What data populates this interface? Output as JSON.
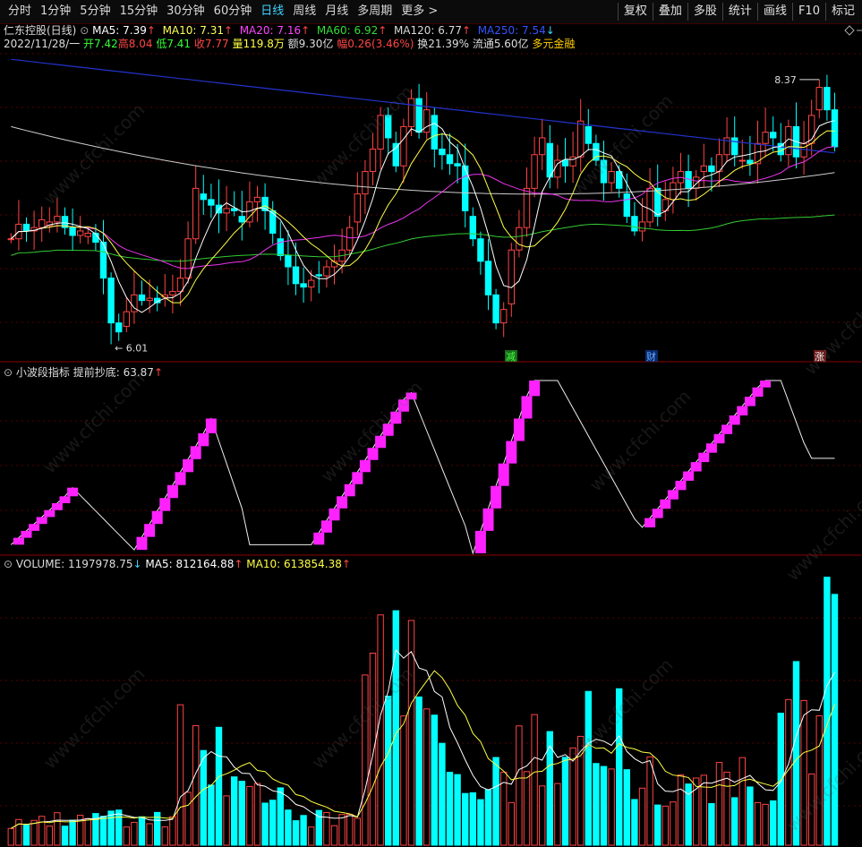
{
  "toolbar": {
    "periods": [
      "分时",
      "1分钟",
      "5分钟",
      "15分钟",
      "30分钟",
      "60分钟",
      "日线",
      "周线",
      "月线",
      "多周期",
      "更多"
    ],
    "active_period": "日线",
    "right_buttons": [
      "复权",
      "叠加",
      "多股",
      "统计",
      "画线",
      "F10",
      "标记"
    ]
  },
  "stock": {
    "name": "仁东控股(日线)",
    "ma": [
      {
        "label": "MA5: 7.39",
        "arrow": "↑",
        "color": "#ffffff"
      },
      {
        "label": "MA10: 7.31",
        "arrow": "↑",
        "color": "#ffff55"
      },
      {
        "label": "MA20: 7.16",
        "arrow": "↑",
        "color": "#ff44ff"
      },
      {
        "label": "MA60: 6.92",
        "arrow": "↑",
        "color": "#33dd33"
      },
      {
        "label": "MA120: 6.77",
        "arrow": "↑",
        "color": "#d8d8d8"
      },
      {
        "label": "MA250: 7.54",
        "arrow": "↓",
        "color": "#3355ff"
      }
    ],
    "quote": {
      "date": "2022/11/28/一",
      "open": "开7.42",
      "high": "高8.04",
      "low": "低7.41",
      "close": "收7.77",
      "vol": "量119.8万",
      "amount": "额9.30亿",
      "change": "幅0.26(3.46%)",
      "turnover": "换21.39%",
      "float": "流通5.60亿",
      "tag": "多元金融"
    },
    "high_mark": "8.37",
    "low_mark": "6.01",
    "events": [
      "减",
      "财",
      "涨"
    ]
  },
  "indicator": {
    "name": "小波段指标",
    "value_label": "提前抄底: 63.87",
    "arrow": "↑"
  },
  "volume": {
    "label": "VOLUME: 1197978.75",
    "label_arrow": "↓",
    "ma5": "MA5: 812164.88",
    "ma5_arrow": "↑",
    "ma10": "MA10: 613854.38",
    "ma10_arrow": "↑"
  },
  "colors": {
    "up": "#ff4444",
    "down": "#00ffff",
    "ma250": "#2233cc",
    "ma120": "#cccccc",
    "ma60": "#33cc33",
    "ma20": "#ee33ee",
    "ma10": "#ffff44",
    "ma5": "#ffffff",
    "indicator": "#ff22ff"
  },
  "watermark": "www.cfchi.com",
  "chart_data": {
    "type": "candlestick",
    "closes": [
      6.95,
      7.08,
      7.02,
      7.05,
      7.12,
      7.1,
      7.15,
      7.05,
      6.98,
      7.02,
      7.0,
      6.92,
      6.6,
      6.2,
      6.12,
      6.3,
      6.45,
      6.4,
      6.42,
      6.38,
      6.45,
      6.48,
      6.6,
      6.95,
      7.4,
      7.3,
      7.25,
      7.18,
      7.22,
      7.2,
      7.1,
      7.28,
      7.32,
      7.2,
      7.0,
      6.8,
      6.7,
      6.55,
      6.52,
      6.58,
      6.62,
      6.7,
      6.75,
      6.85,
      7.05,
      7.35,
      7.55,
      7.75,
      8.05,
      7.85,
      7.6,
      7.95,
      8.2,
      7.9,
      8.1,
      7.75,
      7.7,
      7.62,
      7.6,
      7.2,
      6.95,
      6.75,
      6.45,
      6.2,
      6.32,
      6.85,
      7.05,
      7.4,
      7.7,
      7.85,
      7.5,
      7.65,
      7.6,
      7.68,
      8.0,
      7.8,
      7.65,
      7.45,
      7.55,
      7.4,
      7.15,
      7.02,
      7.1,
      7.4,
      7.15,
      7.3,
      7.45,
      7.55,
      7.4,
      7.5,
      7.6,
      7.55,
      7.7,
      7.85,
      7.7,
      7.65,
      7.62,
      7.8,
      7.9,
      7.85,
      7.7,
      7.95,
      7.68,
      7.8,
      8.05,
      8.3,
      8.1,
      7.77
    ]
  }
}
